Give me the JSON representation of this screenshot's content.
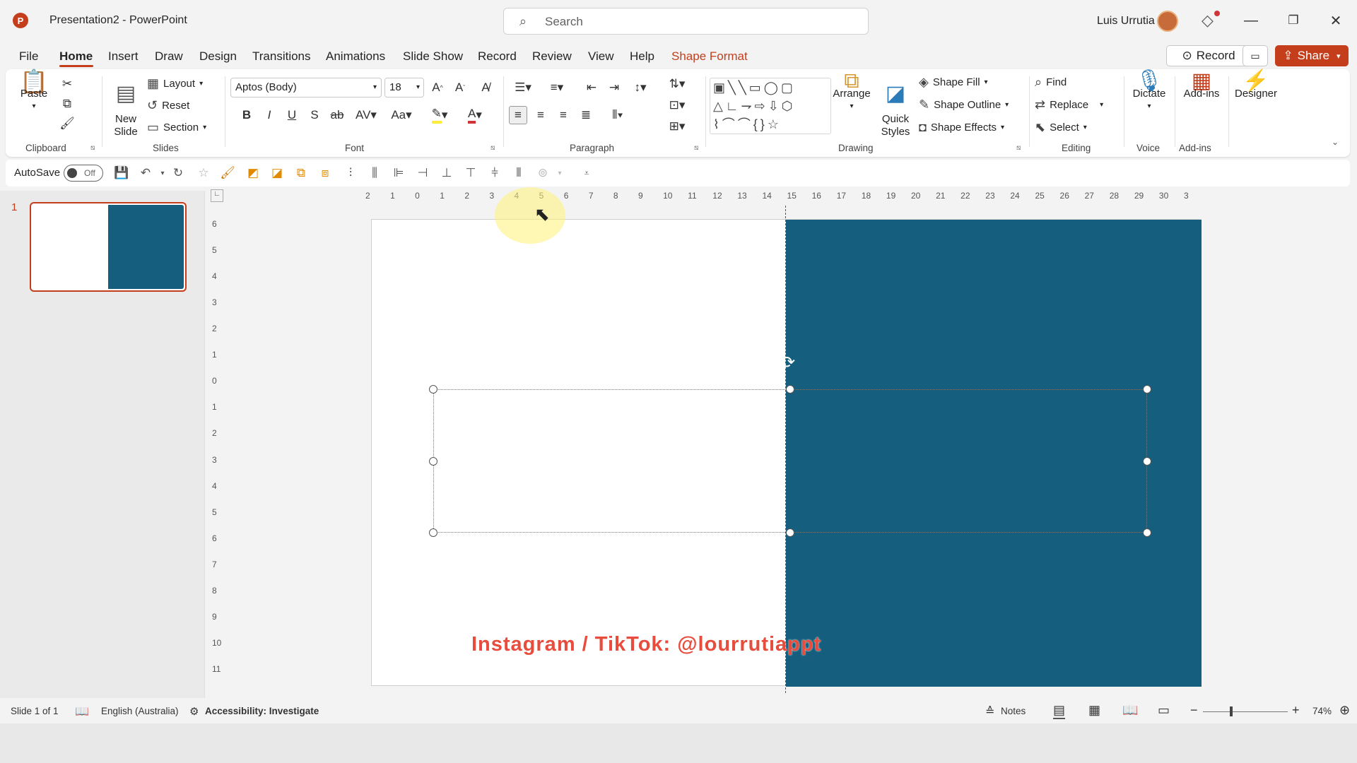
{
  "app": {
    "logo": "P",
    "title": "Presentation2  -  PowerPoint",
    "search_placeholder": "Search",
    "user": "Luis Urrutia",
    "window_controls": {
      "minimize": "—",
      "restore": "❐",
      "close": "✕"
    }
  },
  "menu": {
    "tabs": [
      "File",
      "Home",
      "Insert",
      "Draw",
      "Design",
      "Transitions",
      "Animations",
      "Slide Show",
      "Record",
      "Review",
      "View",
      "Help",
      "Shape Format"
    ],
    "active": "Home",
    "record_label": "Record",
    "share_label": "Share"
  },
  "ribbon": {
    "clipboard": {
      "label": "Clipboard",
      "paste": "Paste"
    },
    "slides": {
      "label": "Slides",
      "new_slide": "New\nSlide",
      "layout": "Layout",
      "reset": "Reset",
      "section": "Section"
    },
    "font": {
      "label": "Font",
      "font_name": "Aptos (Body)",
      "font_size": "18"
    },
    "paragraph": {
      "label": "Paragraph"
    },
    "drawing": {
      "label": "Drawing",
      "arrange": "Arrange",
      "quick_styles": "Quick\nStyles",
      "shape_fill": "Shape Fill",
      "shape_outline": "Shape Outline",
      "shape_effects": "Shape Effects"
    },
    "editing": {
      "label": "Editing",
      "find": "Find",
      "replace": "Replace",
      "select": "Select"
    },
    "voice": {
      "label": "Voice",
      "dictate": "Dictate"
    },
    "addins": {
      "label": "Add-ins",
      "addins": "Add-ins"
    },
    "designer": {
      "designer": "Designer"
    }
  },
  "qat": {
    "autosave": "AutoSave",
    "toggle": "Off"
  },
  "slides_pane": {
    "slide_number": "1"
  },
  "ruler": {
    "horizontal": [
      "2",
      "1",
      "0",
      "1",
      "2",
      "3",
      "4",
      "5",
      "6",
      "7",
      "8",
      "9",
      "10",
      "11",
      "12",
      "13",
      "14",
      "15",
      "16",
      "17",
      "18",
      "19",
      "20",
      "21",
      "22",
      "23",
      "24",
      "25",
      "26",
      "27",
      "28",
      "29",
      "30",
      "3"
    ],
    "vertical": [
      "6",
      "5",
      "4",
      "3",
      "2",
      "1",
      "0",
      "1",
      "2",
      "3",
      "4",
      "5",
      "6",
      "7",
      "8",
      "9",
      "10",
      "11"
    ]
  },
  "slide": {
    "watermark": "Instagram / TikTok: @lourrutiappt",
    "fill_color": "#155e7e"
  },
  "status": {
    "slide_info": "Slide 1 of 1",
    "language": "English (Australia)",
    "accessibility": "Accessibility: Investigate",
    "notes": "Notes",
    "zoom": "74%"
  }
}
